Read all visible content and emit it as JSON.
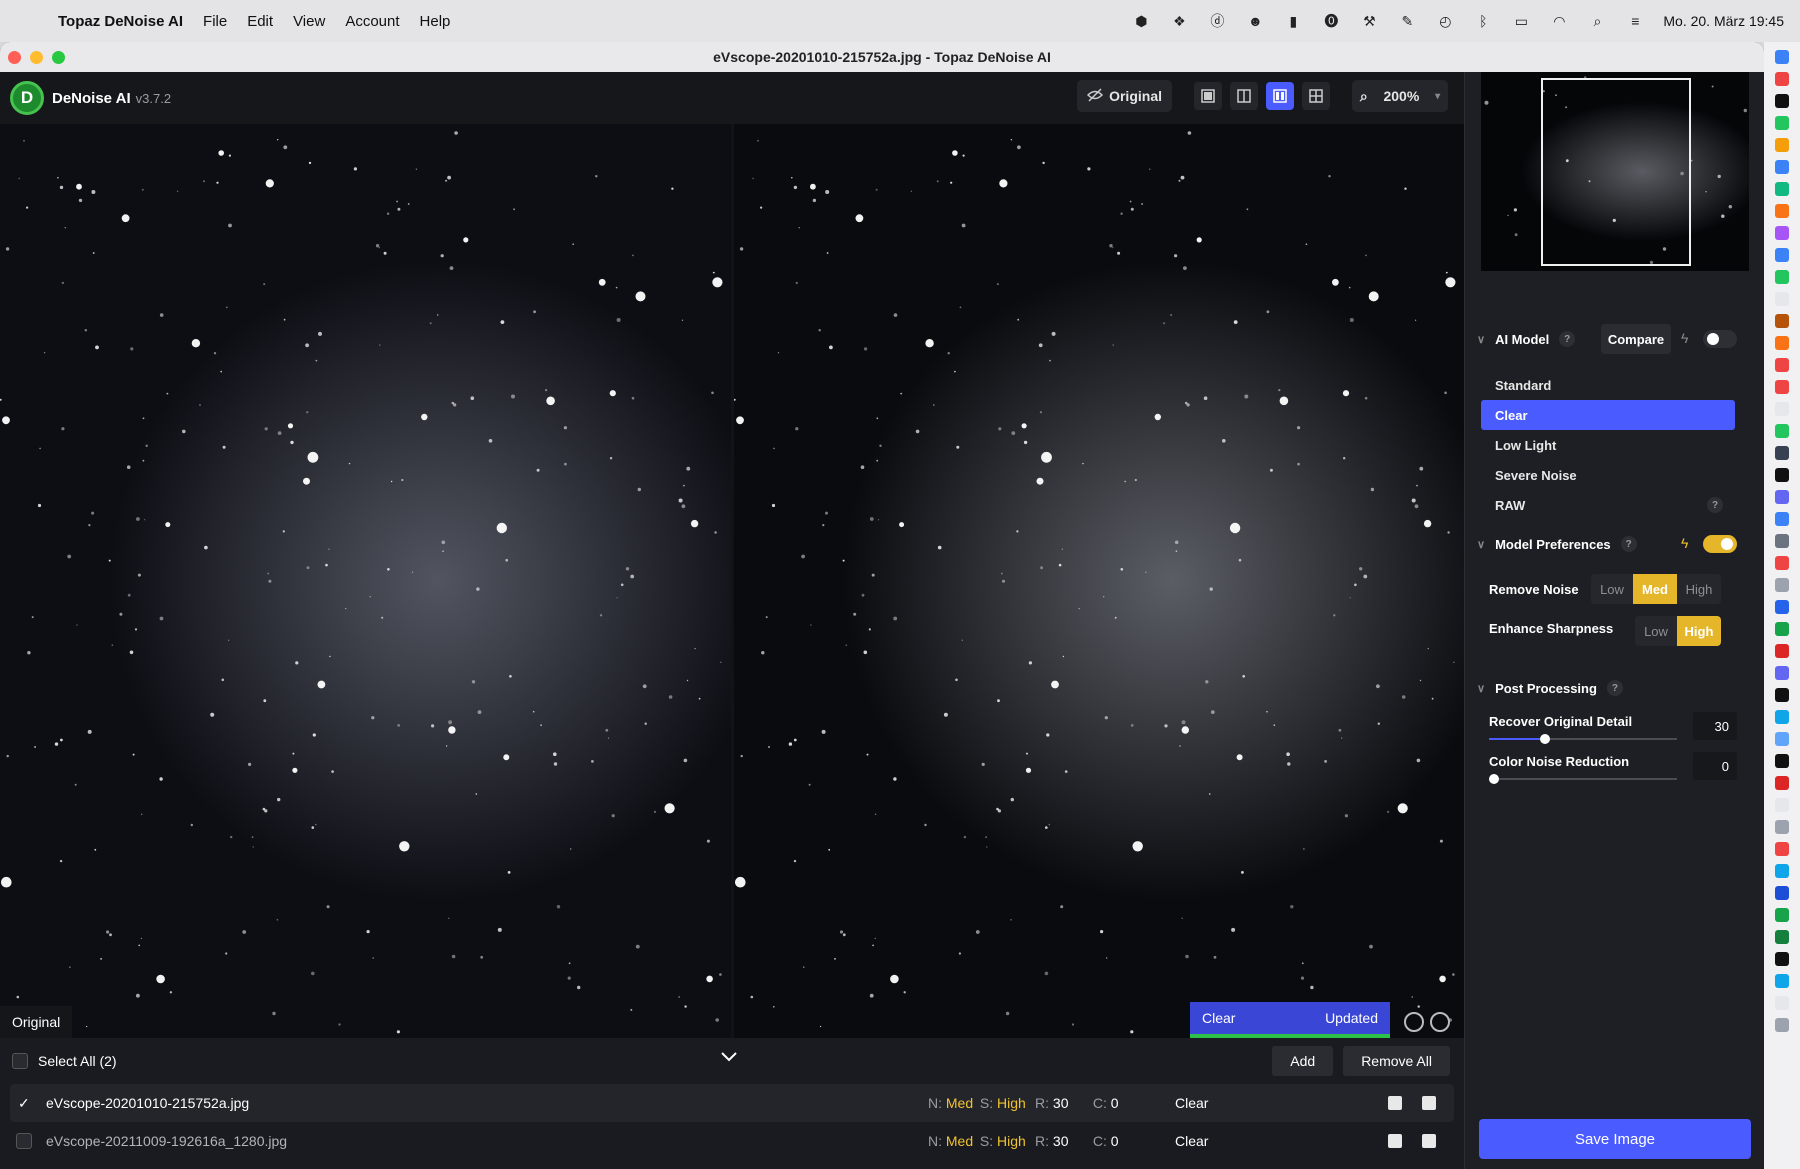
{
  "menubar": {
    "app_name": "Topaz DeNoise AI",
    "menus": [
      "File",
      "Edit",
      "View",
      "Account",
      "Help"
    ],
    "clock": "Mo. 20. März  19:45"
  },
  "window": {
    "title": "eVscope-20201010-215752a.jpg - Topaz DeNoise AI"
  },
  "toolbar": {
    "app_title": "DeNoise AI",
    "version": "v3.7.2",
    "original_label": "Original",
    "zoom": "200%"
  },
  "viewer": {
    "original_label": "Original",
    "model_badge_label": "Clear",
    "status_label": "Updated"
  },
  "filebar": {
    "select_all": "Select All (2)",
    "add": "Add",
    "remove_all": "Remove All",
    "files": [
      {
        "name": "eVscope-20201010-215752a.jpg",
        "n_key": "N:",
        "n_val": "Med",
        "s_key": "S:",
        "s_val": "High",
        "r_key": "R:",
        "r_val": "30",
        "c_key": "C:",
        "c_val": "0",
        "model": "Clear",
        "checked": true
      },
      {
        "name": "eVscope-20211009-192616a_1280.jpg",
        "n_key": "N:",
        "n_val": "Med",
        "s_key": "S:",
        "s_val": "High",
        "r_key": "R:",
        "r_val": "30",
        "c_key": "C:",
        "c_val": "0",
        "model": "Clear",
        "checked": false
      }
    ]
  },
  "sidebar": {
    "ai_model": {
      "title": "AI Model",
      "compare": "Compare",
      "models": [
        "Standard",
        "Clear",
        "Low Light",
        "Severe Noise",
        "RAW"
      ],
      "selected": "Clear"
    },
    "preferences": {
      "title": "Model Preferences",
      "remove_noise_label": "Remove Noise",
      "remove_noise_options": [
        "Low",
        "Med",
        "High"
      ],
      "remove_noise_selected": "Med",
      "enhance_sharpness_label": "Enhance Sharpness",
      "enhance_sharpness_options": [
        "Low",
        "High"
      ],
      "enhance_sharpness_selected": "High"
    },
    "post_processing": {
      "title": "Post Processing",
      "recover_label": "Recover Original Detail",
      "recover_value": "30",
      "color_noise_label": "Color Noise Reduction",
      "color_noise_value": "0"
    },
    "save_button": "Save Image"
  },
  "colors": {
    "accent": "#4a5bff",
    "highlight": "#e5b62a",
    "value_yellow": "#f0c230",
    "progress_green": "#2ec14a"
  },
  "help_glyph": "?",
  "toggles": {
    "compare_on": false,
    "preferences_on": true
  },
  "sliders": {
    "recover_fraction": 0.3,
    "color_noise_fraction": 0.0
  }
}
